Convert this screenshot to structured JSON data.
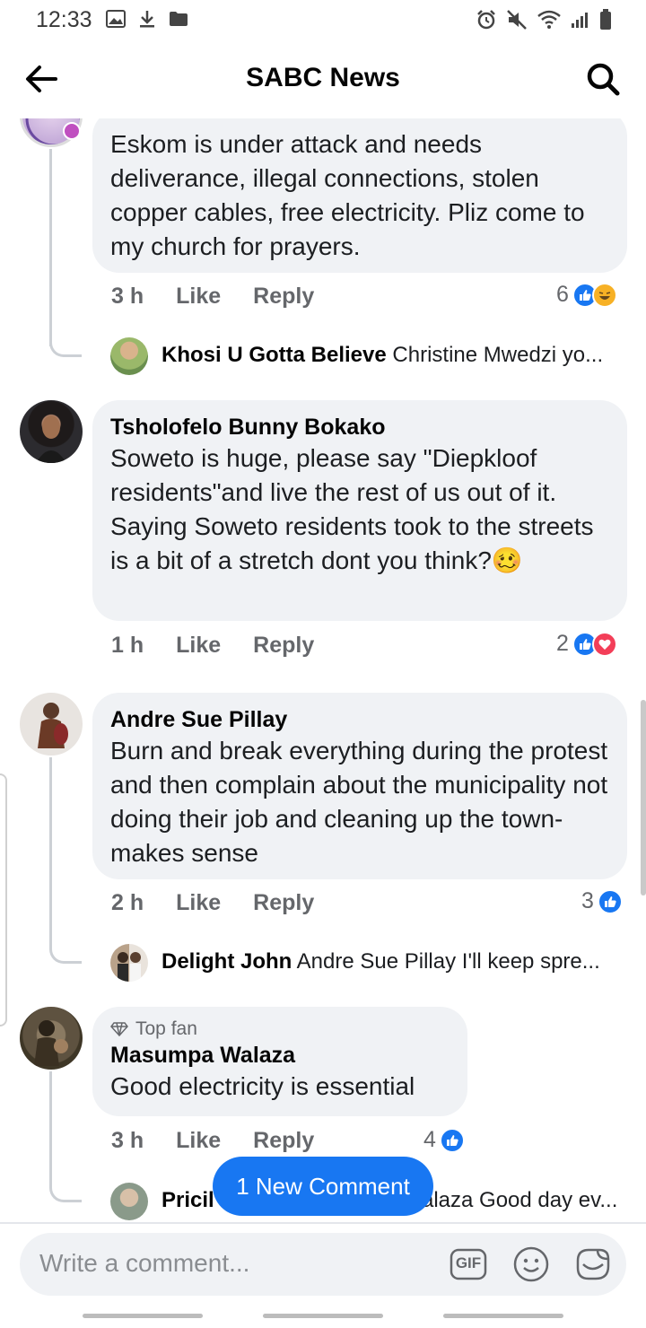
{
  "status_bar": {
    "time": "12:33",
    "left_icons": [
      "gallery-icon",
      "download-icon",
      "folder-icon"
    ],
    "right_icons": [
      "alarm-icon",
      "mute-icon",
      "wifi-icon",
      "signal-icon",
      "battery-icon"
    ]
  },
  "app_bar": {
    "title": "SABC News",
    "back_icon": "arrow-left-icon",
    "search_icon": "search-icon"
  },
  "comments": [
    {
      "name": "",
      "text": "Eskom is under attack and needs deliverance, illegal connections, stolen copper cables, free electricity. Pliz come to my church for prayers.",
      "time": "3 h",
      "like_label": "Like",
      "reply_label": "Reply",
      "reaction_count": "6",
      "reactions": [
        "like",
        "haha"
      ],
      "reply_preview": {
        "name": "Khosi U Gotta Believe",
        "text": "Christine Mwedzi yo..."
      }
    },
    {
      "name": "Tsholofelo Bunny Bokako",
      "text": "Soweto is huge, please say \"Diepkloof residents\"and live the rest of us out of it. Saying Soweto residents took to the streets is a bit of a stretch dont you think?",
      "emoji": "🥴",
      "time": "1 h",
      "like_label": "Like",
      "reply_label": "Reply",
      "reaction_count": "2",
      "reactions": [
        "like",
        "love"
      ]
    },
    {
      "name": "Andre Sue Pillay",
      "text": "Burn and break everything during the protest and then complain about the municipality not doing their job and cleaning up the town-makes sense",
      "time": "2 h",
      "like_label": "Like",
      "reply_label": "Reply",
      "reaction_count": "3",
      "reactions": [
        "like"
      ],
      "reply_preview": {
        "name": "Delight John",
        "text": "Andre Sue Pillay  I'll keep spre..."
      }
    },
    {
      "badge": "Top fan",
      "name": "Masumpa Walaza",
      "text": "Good electricity is essential",
      "time": "3 h",
      "like_label": "Like",
      "reply_label": "Reply",
      "reaction_count": "4",
      "reactions": [
        "like"
      ],
      "reply_preview": {
        "name": "Pricil",
        "text": "alaza Good day ev..."
      }
    }
  ],
  "new_comment_pill": "1 New Comment",
  "composer": {
    "placeholder": "Write a comment...",
    "icons": [
      "gif-icon",
      "emoji-icon",
      "sticker-icon"
    ],
    "gif_label": "GIF"
  },
  "colors": {
    "accent": "#1877f2",
    "bubble": "#f0f2f5",
    "secondary_text": "#65676b",
    "love": "#f33e58",
    "haha": "#f7b125"
  }
}
